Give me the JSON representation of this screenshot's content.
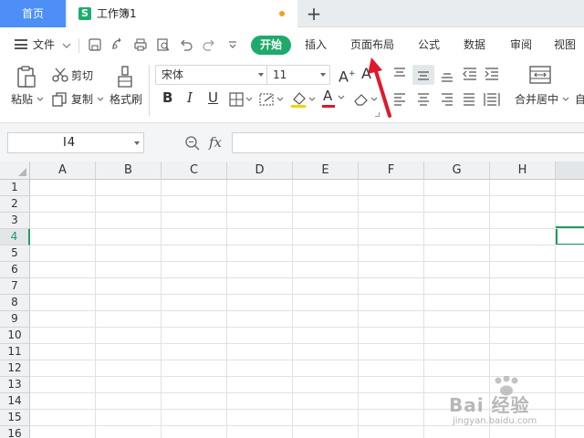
{
  "tabs": {
    "home_label": "首页",
    "doc_icon_letter": "S",
    "doc_title": "工作簿1",
    "new_tab_symbol": "+"
  },
  "menu": {
    "file_label": "文件",
    "items": [
      "开始",
      "插入",
      "页面布局",
      "公式",
      "数据",
      "审阅",
      "视图"
    ],
    "active_index": 0
  },
  "ribbon": {
    "paste_label": "粘贴",
    "cut_label": "剪切",
    "copy_label": "复制",
    "format_painter_label": "格式刷",
    "font_name": "宋体",
    "font_size": "11",
    "bold_label": "B",
    "italic_label": "I",
    "underline_label": "U",
    "merge_label": "合并居中",
    "font_color_label": "A",
    "grow_font_label": "A",
    "shrink_font_label": "A",
    "auto_wrap_label": "自"
  },
  "formula_bar": {
    "cell_ref": "I4",
    "fx_label": "fx",
    "formula_value": ""
  },
  "sheet": {
    "columns": [
      "A",
      "B",
      "C",
      "D",
      "E",
      "F",
      "G",
      "H"
    ],
    "rows": [
      "1",
      "2",
      "3",
      "4",
      "5",
      "6",
      "7",
      "8",
      "9",
      "10",
      "11",
      "12",
      "13",
      "14",
      "15",
      "16"
    ],
    "active_row": "4"
  },
  "watermark": {
    "text": "Bai 经验",
    "url": "jingyan.baidu.com"
  },
  "colors": {
    "accent_green": "#1faa6b",
    "home_tab_blue": "#4d8ff7",
    "arrow_red": "#e0182a"
  }
}
